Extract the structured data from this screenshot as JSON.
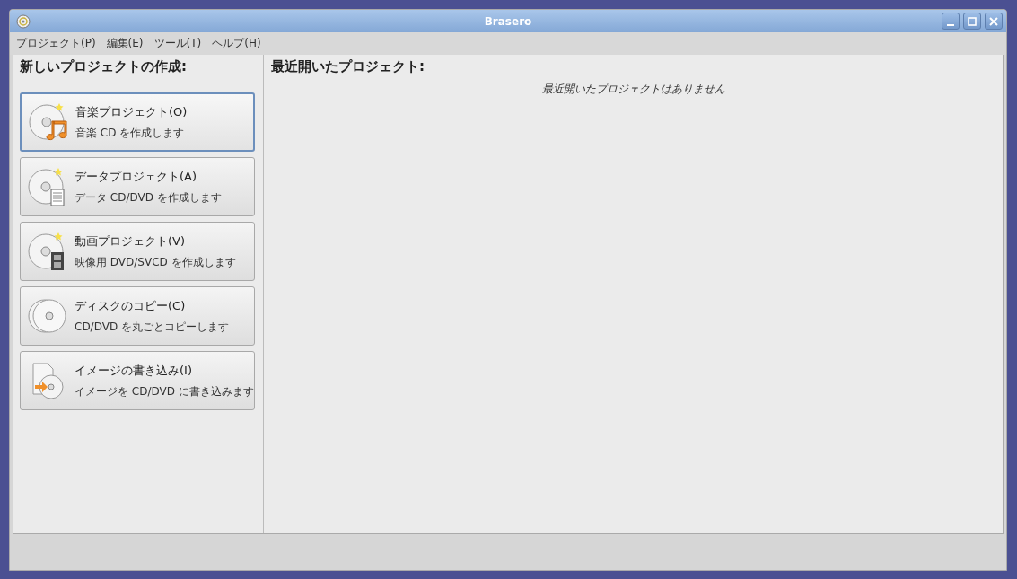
{
  "window": {
    "title": "Brasero"
  },
  "menu": [
    {
      "label": "プロジェクト(P)"
    },
    {
      "label": "編集(E)"
    },
    {
      "label": "ツール(T)"
    },
    {
      "label": "ヘルプ(H)"
    }
  ],
  "new_project": {
    "heading": "新しいプロジェクトの作成:",
    "projects": [
      {
        "kind": "music",
        "title": "音楽プロジェクト(O)",
        "subtitle": "音楽 CD を作成します",
        "selected": true
      },
      {
        "kind": "data",
        "title": "データプロジェクト(A)",
        "subtitle": "データ CD/DVD を作成します",
        "selected": false
      },
      {
        "kind": "video",
        "title": "動画プロジェクト(V)",
        "subtitle": "映像用 DVD/SVCD を作成します",
        "selected": false
      },
      {
        "kind": "copy",
        "title": "ディスクのコピー(C)",
        "subtitle": "CD/DVD を丸ごとコピーします",
        "selected": false
      },
      {
        "kind": "image",
        "title": "イメージの書き込み(I)",
        "subtitle": "イメージを CD/DVD に書き込みます",
        "selected": false
      }
    ]
  },
  "recent": {
    "heading": "最近開いたプロジェクト:",
    "empty_message": "最近開いたプロジェクトはありません"
  }
}
